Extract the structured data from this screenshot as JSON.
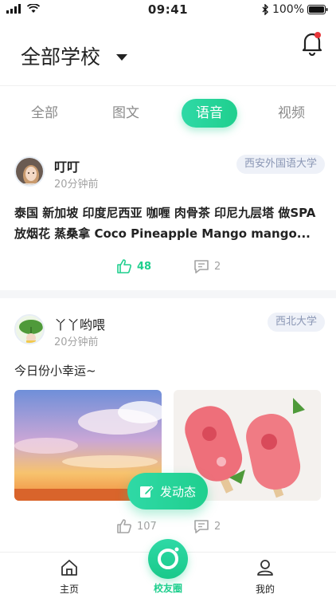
{
  "status_bar": {
    "time": "09:41",
    "battery": "100%"
  },
  "header": {
    "title": "全部学校"
  },
  "tabs": [
    {
      "label": "全部",
      "active": false
    },
    {
      "label": "图文",
      "active": false
    },
    {
      "label": "语音",
      "active": true
    },
    {
      "label": "视频",
      "active": false
    }
  ],
  "posts": [
    {
      "author": "叮叮",
      "time": "20分钟前",
      "school": "西安外国语大学",
      "text_line1": "泰国 新加坡 印度尼西亚 咖喱 肉骨茶 印尼九层塔 做SPA",
      "text_line2": "放烟花 蒸桑拿 Coco Pineapple Mango mango...",
      "likes": "48",
      "comments": "2"
    },
    {
      "author": "丫丫哟喂",
      "time": "20分钟前",
      "school": "西北大学",
      "text": "今日份小幸运~",
      "likes": "107",
      "comments": "2"
    }
  ],
  "fab": {
    "label": "发动态"
  },
  "tabbar": {
    "home": "主页",
    "circle": "校友圈",
    "me": "我的"
  },
  "colors": {
    "accent": "#1fcf8e",
    "badge_bg": "#eef1f8",
    "badge_text": "#8a96b4"
  }
}
